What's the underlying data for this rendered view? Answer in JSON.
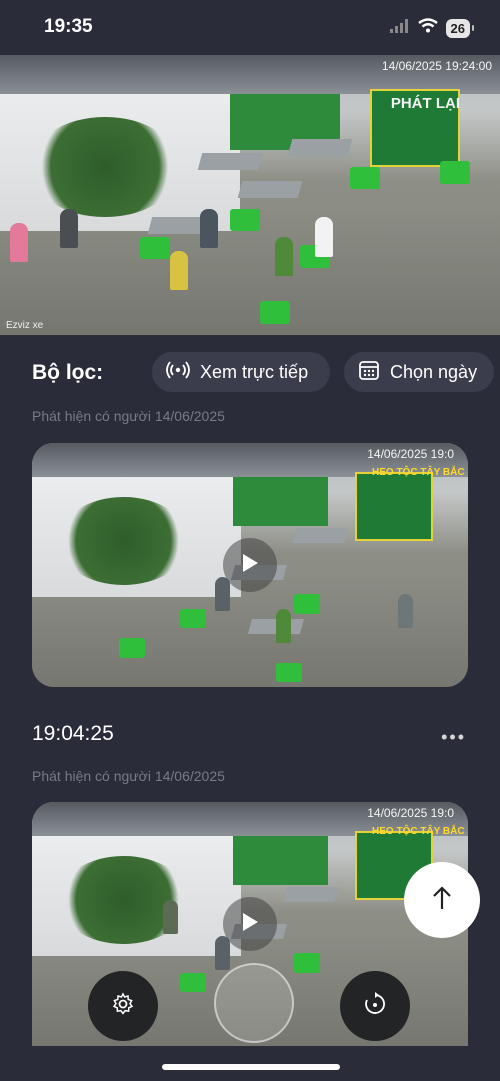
{
  "status": {
    "time": "19:35",
    "battery": "26"
  },
  "live": {
    "overlay_datetime": "14/06/2025  19:24:00",
    "playback_label": "PHÁT LẠI",
    "watermark": "Ezviz xe"
  },
  "filter": {
    "label": "Bộ lọc:",
    "live_button": "Xem trực tiếp",
    "date_button": "Chọn ngày"
  },
  "events": [
    {
      "caption": "Phát hiện có người 14/06/2025",
      "overlay_datetime": "14/06/2025 19:0",
      "sign": "HEO TỘC TÂY BẮC",
      "time": ""
    },
    {
      "caption": "Phát hiện có người 14/06/2025",
      "overlay_datetime": "14/06/2025 19:0",
      "sign": "HEO TỘC TÂY BẮC",
      "time": "19:04:25"
    }
  ],
  "more_label": "•••",
  "icons": {
    "signal": "signal-icon",
    "wifi": "wifi-icon",
    "live": "broadcast-icon",
    "calendar": "calendar-icon",
    "play": "play-icon",
    "up": "arrow-up-icon",
    "settings": "gear-icon",
    "replay": "replay-icon"
  }
}
